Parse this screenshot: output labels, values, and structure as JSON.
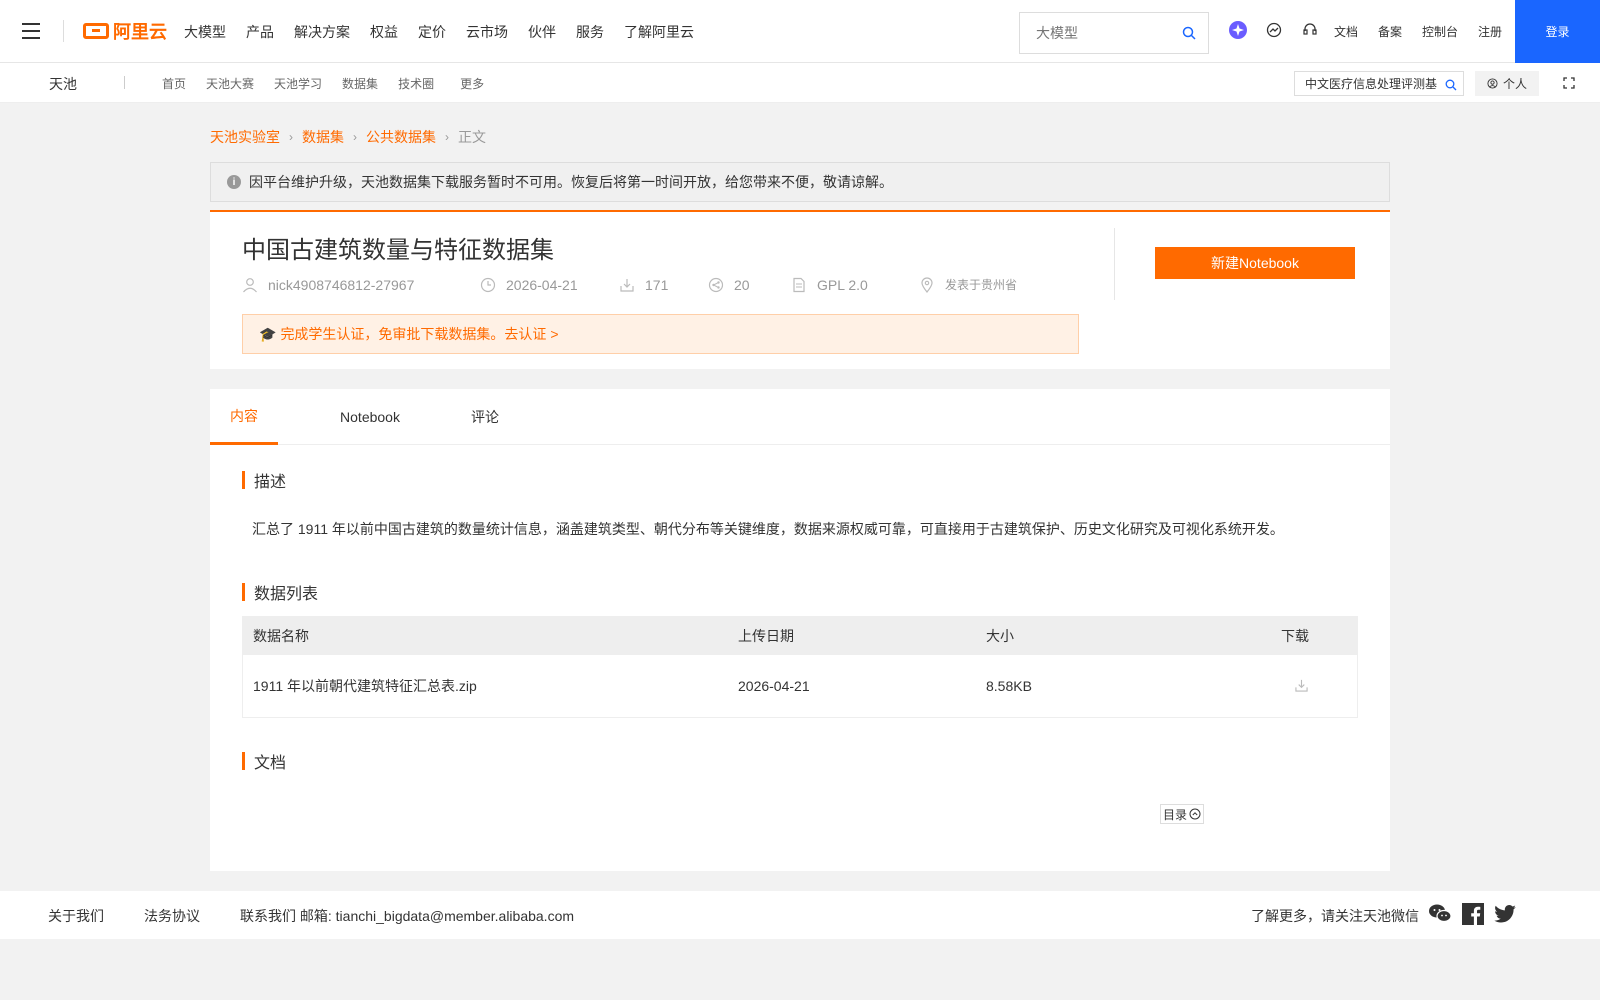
{
  "topnav": {
    "logo_text": "阿里云",
    "menu": [
      "大模型",
      "产品",
      "解决方案",
      "权益",
      "定价",
      "云市场",
      "伙伴",
      "服务",
      "了解阿里云"
    ],
    "search_placeholder": "大模型",
    "links": [
      "文档",
      "备案",
      "控制台",
      "注册"
    ],
    "login_label": "登录",
    "icons": [
      "tongyi-icon",
      "explore-icon",
      "support-icon"
    ]
  },
  "subnav": {
    "brand": "天池",
    "links": [
      "首页",
      "天池大赛",
      "天池学习",
      "数据集",
      "技术圈",
      "更多"
    ],
    "search_value": "中文医疗信息处理评测基",
    "personal_label": "个人"
  },
  "breadcrumb": {
    "items": [
      "天池实验室",
      "数据集",
      "公共数据集"
    ],
    "current": "正文"
  },
  "notice": {
    "text": "因平台维护升级，天池数据集下载服务暂时不可用。恢复后将第一时间开放，给您带来不便，敬请谅解。"
  },
  "dataset": {
    "title": "中国古建筑数量与特征数据集",
    "author": "nick4908746812-27967",
    "date": "2026-04-21",
    "downloads": "171",
    "shares": "20",
    "license": "GPL 2.0",
    "location": "发表于贵州省",
    "new_notebook_label": "新建Notebook",
    "cert_text": "完成学生认证，免审批下载数据集。去认证 >"
  },
  "tabs": {
    "items": [
      "内容",
      "Notebook",
      "评论"
    ],
    "active": "内容"
  },
  "sections": {
    "desc_title": "描述",
    "desc_text": "汇总了 1911 年以前中国古建筑的数量统计信息，涵盖建筑类型、朝代分布等关键维度，数据来源权威可靠，可直接用于古建筑保护、历史文化研究及可视化系统开发。",
    "list_title": "数据列表",
    "doc_title": "文档",
    "toc_label": "目录"
  },
  "table": {
    "headers": [
      "数据名称",
      "上传日期",
      "大小",
      "下载"
    ],
    "rows": [
      {
        "name": "1911 年以前朝代建筑特征汇总表.zip",
        "date": "2026-04-21",
        "size": "8.58KB"
      }
    ]
  },
  "footer": {
    "about": "关于我们",
    "legal": "法务协议",
    "contact": "联系我们 邮箱: tianchi_bigdata@member.alibaba.com",
    "follow": "了解更多，请关注天池微信"
  },
  "colors": {
    "accent": "#ff6a00",
    "login_blue": "#1a66ff"
  }
}
